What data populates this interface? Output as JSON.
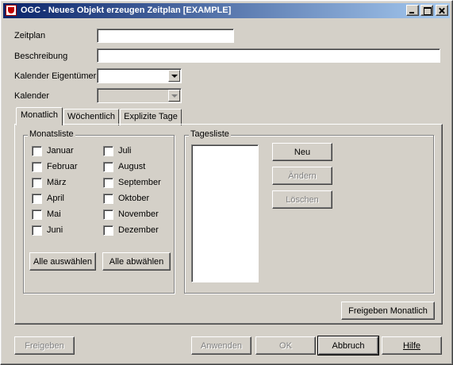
{
  "window": {
    "title": "OGC - Neues Objekt erzeugen Zeitplan [EXAMPLE]",
    "controls": [
      "minimize-icon",
      "maximize-icon",
      "close-icon"
    ]
  },
  "form": {
    "zeitplan_label": "Zeitplan",
    "zeitplan_value": "",
    "beschreibung_label": "Beschreibung",
    "beschreibung_value": "",
    "kalender_eigentuemer_label": "Kalender Eigentümer",
    "kalender_eigentuemer_value": "",
    "kalender_label": "Kalender",
    "kalender_value": ""
  },
  "tabs": [
    {
      "label": "Monatlich",
      "active": true
    },
    {
      "label": "Wöchentlich",
      "active": false
    },
    {
      "label": "Explizite Tage",
      "active": false
    }
  ],
  "monatsliste": {
    "title": "Monatsliste",
    "months_left": [
      "Januar",
      "Februar",
      "März",
      "April",
      "Mai",
      "Juni"
    ],
    "months_right": [
      "Juli",
      "August",
      "September",
      "Oktober",
      "November",
      "Dezember"
    ],
    "select_all": "Alle auswählen",
    "deselect_all": "Alle abwählen"
  },
  "tagesliste": {
    "title": "Tagesliste",
    "new": "Neu",
    "edit": "Ändern",
    "delete": "Löschen"
  },
  "freigeben_monatlich": "Freigeben Monatlich",
  "footer": {
    "freigeben": "Freigeben",
    "anwenden": "Anwenden",
    "ok": "OK",
    "abbruch": "Abbruch",
    "hilfe": "Hilfe"
  }
}
